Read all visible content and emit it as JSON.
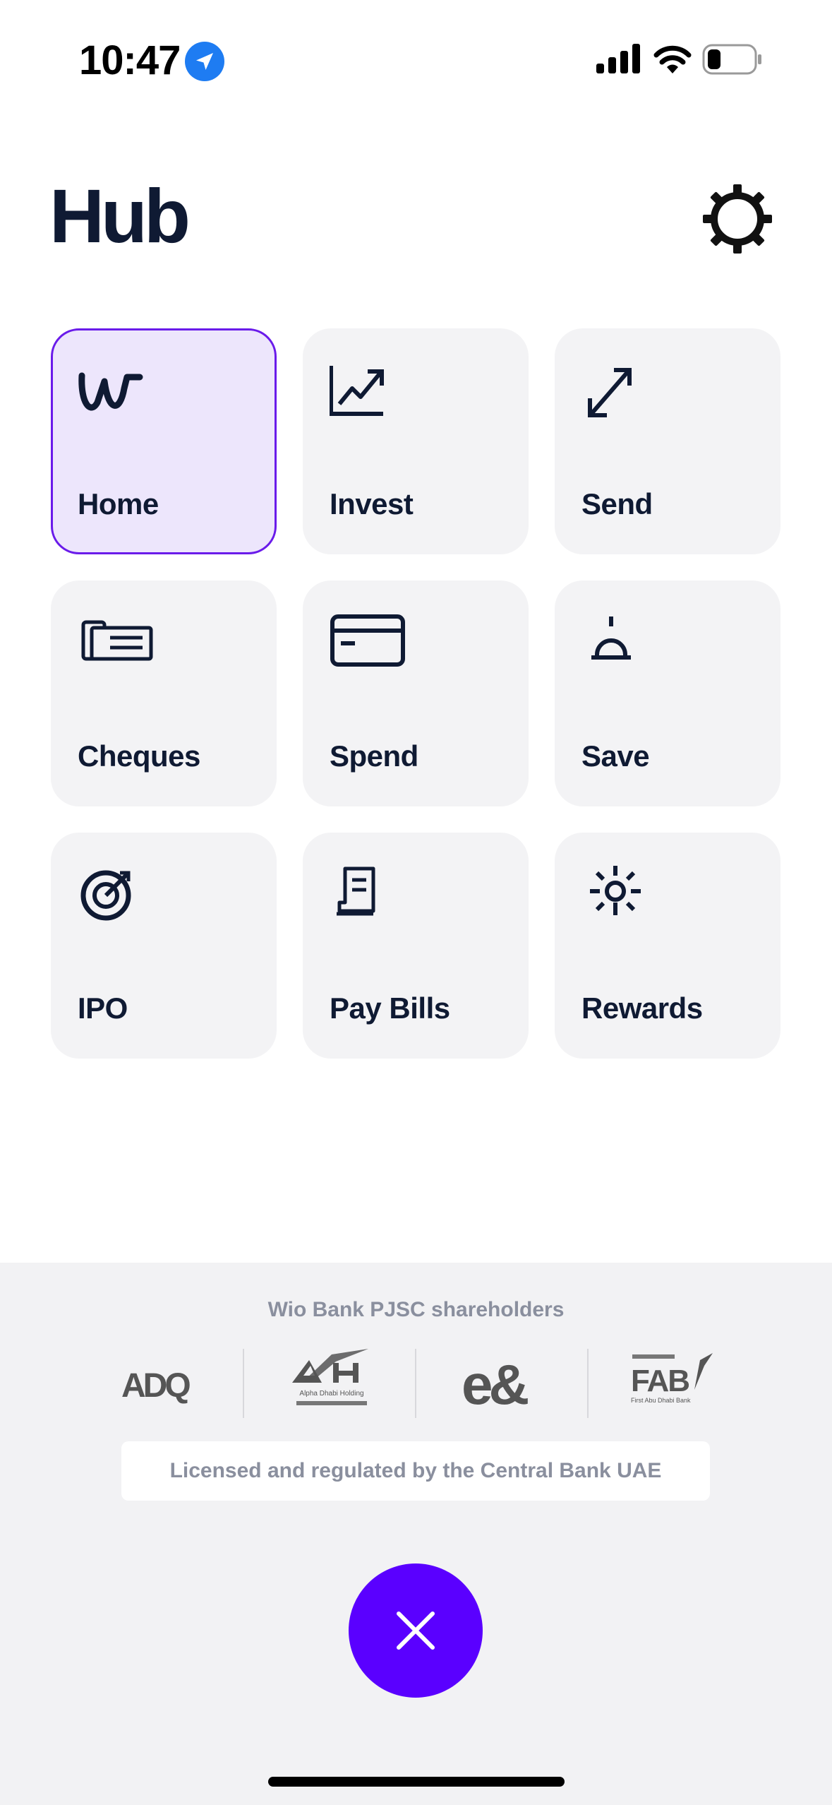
{
  "status_bar": {
    "time": "10:47"
  },
  "header": {
    "title": "Hub"
  },
  "tiles": [
    {
      "label": "Home",
      "icon": "wio-logo-icon",
      "active": true
    },
    {
      "label": "Invest",
      "icon": "chart-up-icon"
    },
    {
      "label": "Send",
      "icon": "arrows-expand-icon"
    },
    {
      "label": "Cheques",
      "icon": "cheque-icon"
    },
    {
      "label": "Spend",
      "icon": "card-icon"
    },
    {
      "label": "Save",
      "icon": "bell-icon"
    },
    {
      "label": "IPO",
      "icon": "target-icon"
    },
    {
      "label": "Pay Bills",
      "icon": "receipt-icon"
    },
    {
      "label": "Rewards",
      "icon": "sparkle-icon"
    }
  ],
  "footer": {
    "shareholders_title": "Wio Bank PJSC shareholders",
    "logos": [
      "ADQ",
      "Alpha Dhabi Holding",
      "e&",
      "FAB"
    ],
    "logo_subtexts": {
      "adh": "Alpha Dhabi Holding",
      "fab": "First Abu Dhabi Bank"
    },
    "license": "Licensed and regulated by the Central Bank UAE"
  },
  "colors": {
    "accent": "#5a00ff",
    "active_tile_bg": "#ede6fc",
    "active_tile_border": "#6a1bea",
    "text": "#0f1a33"
  }
}
